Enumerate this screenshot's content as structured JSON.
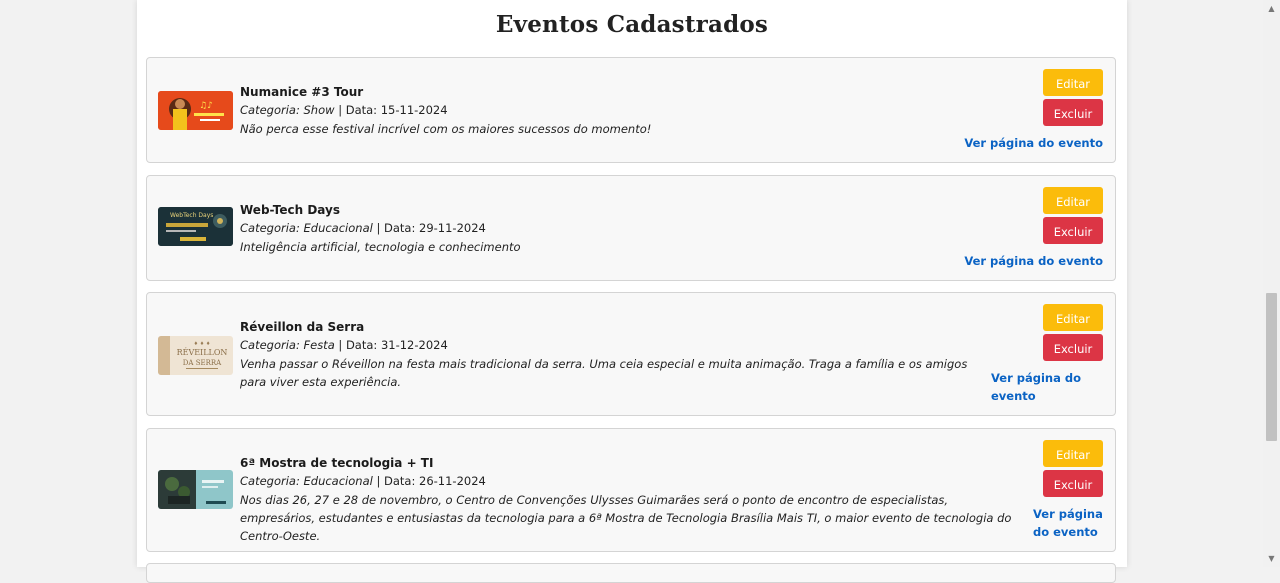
{
  "page_title": "Eventos Cadastrados",
  "category_label": "Categoria:",
  "date_label": "Data:",
  "separator": "|",
  "buttons": {
    "edit": "Editar",
    "delete": "Excluir"
  },
  "events": [
    {
      "name": "Numanice #3 Tour",
      "category": "Show",
      "date": "15-11-2024",
      "description": "Não perca esse festival incrível com os maiores sucessos do momento!",
      "link": "Ver página do evento"
    },
    {
      "name": "Web-Tech Days",
      "category": "Educacional",
      "date": "29-11-2024",
      "description": "Inteligência artificial, tecnologia e conhecimento",
      "link": "Ver página do evento"
    },
    {
      "name": "Réveillon da Serra",
      "category": "Festa",
      "date": "31-12-2024",
      "description": "Venha passar o Réveillon na festa mais tradicional da serra. Uma ceia especial e muita animação. Traga a família e os amigos para viver esta experiência.",
      "link": "Ver página do evento"
    },
    {
      "name": "6ª Mostra de tecnologia + TI",
      "category": "Educacional",
      "date": "26-11-2024",
      "description": "Nos dias 26, 27 e 28 de novembro, o Centro de Convenções Ulysses Guimarães será o ponto de encontro de especialistas, empresários, estudantes e entusiastas da tecnologia para a 6ª Mostra de Tecnologia Brasília Mais TI, o maior evento de tecnologia do Centro-Oeste.",
      "link": "Ver página do evento"
    }
  ],
  "colors": {
    "edit_button": "#fbbc0b",
    "delete_button": "#dc3545",
    "link": "#0b63c4"
  }
}
